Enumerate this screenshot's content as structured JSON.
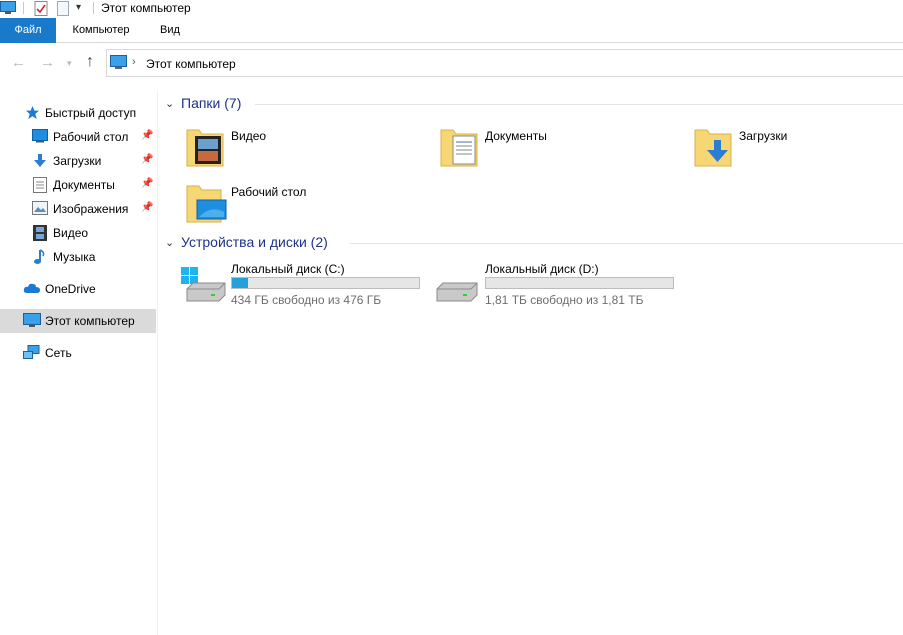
{
  "window": {
    "title": "Этот компьютер"
  },
  "ribbon": {
    "tabs": [
      "Файл",
      "Компьютер",
      "Вид"
    ],
    "accent": "#1979ca"
  },
  "address": {
    "path": "Этот компьютер"
  },
  "nav": {
    "quick_access": "Быстрый доступ",
    "pinned": [
      {
        "label": "Рабочий стол",
        "icon": "desktop-icon",
        "pinned": true
      },
      {
        "label": "Загрузки",
        "icon": "downloads-icon",
        "pinned": true
      },
      {
        "label": "Документы",
        "icon": "documents-icon",
        "pinned": true
      },
      {
        "label": "Изображения",
        "icon": "pictures-icon",
        "pinned": true
      },
      {
        "label": "Видео",
        "icon": "videos-icon",
        "pinned": false
      },
      {
        "label": "Музыка",
        "icon": "music-icon",
        "pinned": false
      }
    ],
    "onedrive": "OneDrive",
    "this_pc": "Этот компьютер",
    "network": "Сеть"
  },
  "folders": {
    "header": "Папки (7)",
    "items": [
      {
        "label": "Видео",
        "icon": "videos-folder-icon"
      },
      {
        "label": "Документы",
        "icon": "documents-folder-icon"
      },
      {
        "label": "Загрузки",
        "icon": "downloads-folder-icon"
      },
      {
        "label": "Рабочий стол",
        "icon": "desktop-folder-icon"
      }
    ]
  },
  "drives": {
    "header": "Устройства и диски (2)",
    "items": [
      {
        "name": "Локальный диск (C:)",
        "free_text": "434 ГБ свободно из 476 ГБ",
        "used_fraction": 0.088,
        "bar_color": "#26a0da"
      },
      {
        "name": "Локальный диск (D:)",
        "free_text": "1,81 ТБ свободно из 1,81 ТБ",
        "used_fraction": 0.0,
        "bar_color": "#26a0da"
      }
    ]
  }
}
